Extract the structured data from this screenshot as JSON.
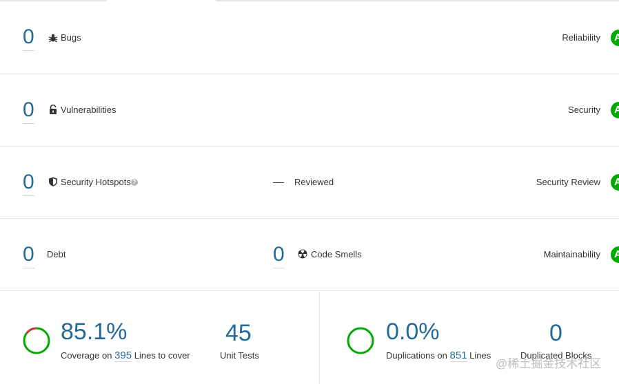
{
  "rows": {
    "bugs": {
      "value": "0",
      "label": "Bugs",
      "category": "Reliability",
      "rating": "A"
    },
    "vulnerabilities": {
      "value": "0",
      "label": "Vulnerabilities",
      "category": "Security",
      "rating": "A"
    },
    "hotspots": {
      "value": "0",
      "label": "Security Hotspots",
      "reviewed_value": "—",
      "reviewed_label": "Reviewed",
      "category": "Security Review",
      "rating": "A"
    },
    "maintainability": {
      "debt_value": "0",
      "debt_label": "Debt",
      "smells_value": "0",
      "smells_label": "Code Smells",
      "category": "Maintainability",
      "rating": "A"
    }
  },
  "coverage": {
    "percent": "85.1%",
    "percent_value": 85.1,
    "prefix": "Coverage on",
    "lines": "395",
    "suffix": "Lines to cover",
    "unit_tests_value": "45",
    "unit_tests_label": "Unit Tests"
  },
  "duplications": {
    "percent": "0.0%",
    "percent_value": 0.0,
    "prefix": "Duplications on",
    "lines": "851",
    "suffix": "Lines",
    "blocks_value": "0",
    "blocks_label": "Duplicated Blocks"
  },
  "watermark": "@稀土掘金技术社区",
  "colors": {
    "link": "#236a97",
    "rating_a": "#00aa00",
    "coverage_ring": "#00aa00",
    "uncovered_ring": "#d4333f"
  },
  "icons": {
    "bugs": "bug-icon",
    "vulnerabilities": "lock-icon",
    "hotspots": "shield-icon",
    "help": "help-icon",
    "smells": "radiation-icon"
  }
}
